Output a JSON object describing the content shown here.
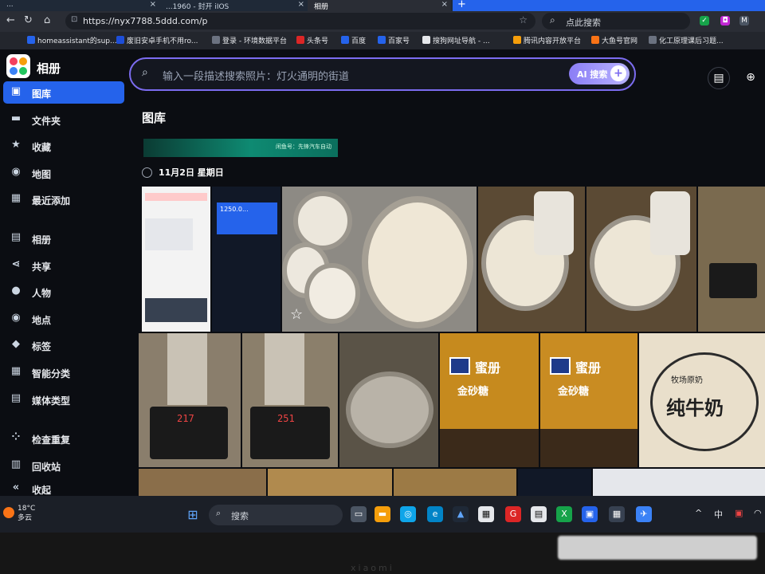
{
  "browser": {
    "tabs": [
      {
        "label": "...",
        "active": false
      },
      {
        "label": "...1960 - 封开 iIOS",
        "active": false
      },
      {
        "label": "相册",
        "active": true
      }
    ],
    "url": "https://nyx7788.5ddd.com/p",
    "search_placeholder": "点此搜索"
  },
  "bookmarks": [
    {
      "label": "homeassistant的sup...",
      "color": "#2563eb"
    },
    {
      "label": "废旧安卓手机不用ro...",
      "color": "#1d4ed8"
    },
    {
      "label": "登录 - 环境数据平台",
      "color": "#6b7280"
    },
    {
      "label": "头条号",
      "color": "#dc2626"
    },
    {
      "label": "百度",
      "color": "#2563eb"
    },
    {
      "label": "百家号",
      "color": "#2563eb"
    },
    {
      "label": "搜狗网址导航 - ...",
      "color": "#e5e7eb"
    },
    {
      "label": "腾讯内容开放平台",
      "color": "#f59e0b"
    },
    {
      "label": "大鱼号官网",
      "color": "#f97316"
    },
    {
      "label": "化工原理课后习题...",
      "color": "#6b7280"
    }
  ],
  "app": {
    "title": "相册",
    "search_placeholder": "输入一段描述搜索照片：灯火通明的街道",
    "ai_button": "AI 搜索",
    "page_title": "图库",
    "banner_text": "闲鱼号：先锋汽车自动",
    "date_group": "11月2日 星期日"
  },
  "sidebar": [
    {
      "label": "图库",
      "icon": "image-icon",
      "glyph": "▣",
      "active": true
    },
    {
      "label": "文件夹",
      "icon": "folder-icon",
      "glyph": "▬",
      "active": false
    },
    {
      "label": "收藏",
      "icon": "star-icon",
      "glyph": "★",
      "active": false
    },
    {
      "label": "地图",
      "icon": "map-pin-icon",
      "glyph": "◉",
      "active": false
    },
    {
      "label": "最近添加",
      "icon": "calendar-icon",
      "glyph": "▦",
      "active": false
    },
    {
      "label": "相册",
      "icon": "album-icon",
      "glyph": "▤",
      "active": false
    },
    {
      "label": "共享",
      "icon": "share-icon",
      "glyph": "⋖",
      "active": false
    },
    {
      "label": "人物",
      "icon": "person-icon",
      "glyph": "●",
      "active": false
    },
    {
      "label": "地点",
      "icon": "location-icon",
      "glyph": "◉",
      "active": false
    },
    {
      "label": "标签",
      "icon": "tag-icon",
      "glyph": "◆",
      "active": false
    },
    {
      "label": "智能分类",
      "icon": "grid-icon",
      "glyph": "▦",
      "active": false
    },
    {
      "label": "媒体类型",
      "icon": "media-type-icon",
      "glyph": "▤",
      "active": false
    },
    {
      "label": "检查重复",
      "icon": "duplicate-icon",
      "glyph": "⁘",
      "active": false
    },
    {
      "label": "回收站",
      "icon": "trash-icon",
      "glyph": "▥",
      "active": false
    },
    {
      "label": "收起",
      "icon": "collapse-icon",
      "glyph": "«",
      "active": false
    }
  ],
  "photos_row1": [
    {
      "desc": "phone-screenshot-news",
      "bg": "#f3f3f3"
    },
    {
      "desc": "phone-screenshot-app-1250",
      "bg": "#111827",
      "text": "1250.0..."
    },
    {
      "desc": "soymilk-bowls",
      "bg": "#c9c3b6"
    },
    {
      "desc": "pouring-soymilk-1",
      "bg": "#ddd6c8"
    },
    {
      "desc": "pouring-soymilk-2",
      "bg": "#d8d1c2"
    },
    {
      "desc": "soymilk-maker-display",
      "bg": "#6b5b3e"
    }
  ],
  "photos_row2": [
    {
      "desc": "soymilk-maker-217",
      "bg": "#8a7e6c",
      "display": "217"
    },
    {
      "desc": "soymilk-maker-251",
      "bg": "#8b7f6b",
      "display": "251"
    },
    {
      "desc": "steel-pot",
      "bg": "#5a5347"
    },
    {
      "desc": "honey-jar-1",
      "bg": "#c68a1e",
      "label": "蜜册",
      "sub": "金砂糖"
    },
    {
      "desc": "honey-jar-2",
      "bg": "#c98c22",
      "label": "蜜册",
      "sub": "金砂糖"
    },
    {
      "desc": "pure-milk-bag",
      "bg": "#e9dfcb",
      "label": "纯牛奶",
      "sub": "牧场原奶"
    }
  ],
  "taskbar": {
    "weather_temp": "18°C",
    "weather_desc": "多云",
    "search_label": "搜索",
    "lang": "中"
  }
}
